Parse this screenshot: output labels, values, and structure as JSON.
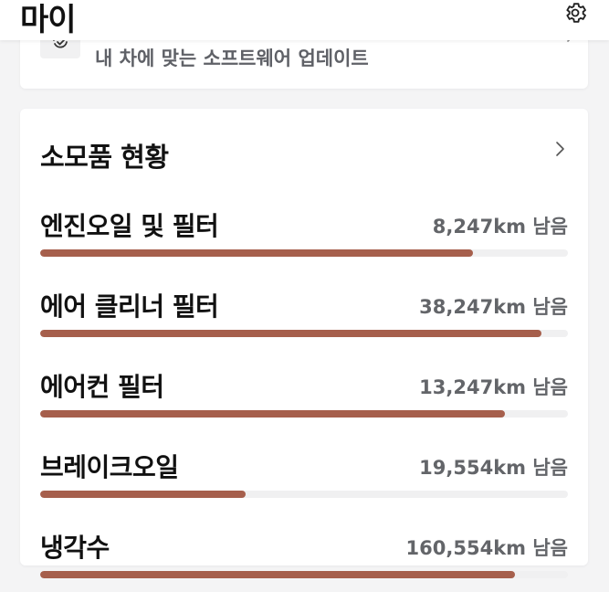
{
  "header": {
    "title": "마이"
  },
  "software_update": {
    "text": "내 차에 맞는 소프트웨어 업데이트"
  },
  "consumables": {
    "title": "소모품 현황",
    "items": [
      {
        "name": "엔진오일 및 필터",
        "remaining": "8,247km 남음",
        "progress": 0.82
      },
      {
        "name": "에어 클리너 필터",
        "remaining": "38,247km 남음",
        "progress": 0.95
      },
      {
        "name": "에어컨 필터",
        "remaining": "13,247km 남음",
        "progress": 0.88
      },
      {
        "name": "브레이크오일",
        "remaining": "19,554km 남음",
        "progress": 0.39
      },
      {
        "name": "냉각수",
        "remaining": "160,554km 남음",
        "progress": 0.9
      }
    ]
  },
  "colors": {
    "accent": "#a65f4c",
    "track": "#f0f0f1",
    "background": "#f4f4f5"
  }
}
